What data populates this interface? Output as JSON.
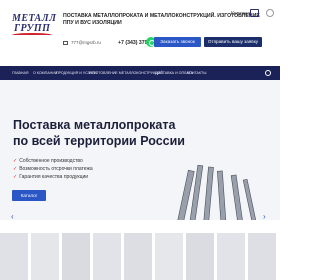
{
  "header": {
    "logo_line1": "МЕТАЛЛ",
    "logo_line2": "ГРУПП",
    "tagline": "ПОСТАВКА МЕТАЛЛОПРОКАТА И МЕТАЛЛОКОНСТРУКЦИЙ. ИЗГОТОВЛЕНИЕ ППУ И ВУС ИЗОЛЯЦИИ",
    "cart_label": "Корзина",
    "email": "777@mgsrb.ru",
    "phone": "+7 (343) 379-98-96",
    "call_button": "Заказать звонок",
    "order_button": "Отправить вашу заявку"
  },
  "nav": {
    "items": [
      "Главная",
      "О компании",
      "Продукция и услуги",
      "Изготовление металлоконструкций",
      "Доставка и оплата",
      "Контакты"
    ]
  },
  "hero": {
    "title_line1": "Поставка металлопроката",
    "title_line2": "по всей территории России",
    "bullets": [
      "Собственное производство",
      "Возможность отсрочки платежа",
      "Гарантия качества продукции"
    ],
    "more_button": "Каталог",
    "arrow_left": "‹",
    "arrow_right": "›"
  },
  "colors": {
    "brand_navy": "#1b2257",
    "button_blue": "#2a56c6",
    "accent_red": "#d2232a",
    "whatsapp_green": "#25d366"
  }
}
